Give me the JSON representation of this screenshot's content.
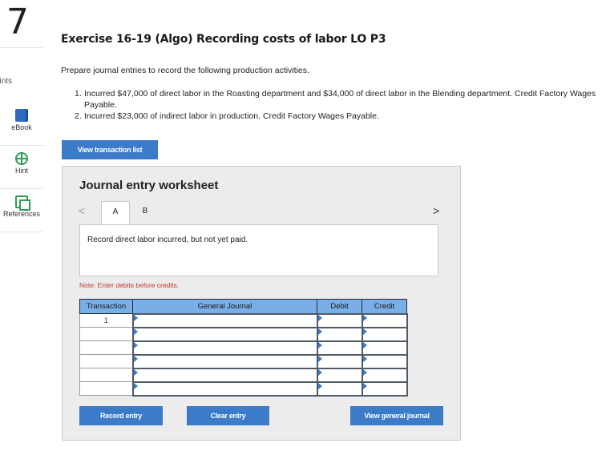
{
  "question": {
    "number": "7",
    "points_label": "oints"
  },
  "rail": [
    {
      "label": "eBook",
      "icon": "book-icon"
    },
    {
      "label": "Hint",
      "icon": "hint-icon"
    },
    {
      "label": "References",
      "icon": "references-icon"
    }
  ],
  "exercise": {
    "title": "Exercise 16-19 (Algo) Recording costs of labor LO P3",
    "intro": "Prepare journal entries to record the following production activities.",
    "items": [
      {
        "num": "1.",
        "text": "Incurred $47,000 of direct labor in the Roasting department and $34,000 of direct labor in the Blending department. Credit Factory Wages Payable."
      },
      {
        "num": "2.",
        "text": "Incurred $23,000 of indirect labor in production. Credit Factory Wages Payable."
      }
    ]
  },
  "buttons": {
    "view_transactions": "View transaction list",
    "record_entry": "Record entry",
    "clear_entry": "Clear entry",
    "view_general_journal": "View general journal"
  },
  "worksheet": {
    "title": "Journal entry worksheet",
    "prev_glyph": "<",
    "next_glyph": ">",
    "tabs": [
      "A",
      "B"
    ],
    "active_tab": "A",
    "description": "Record direct labor incurred, but not yet paid.",
    "note": "Note: Enter debits before credits.",
    "columns": [
      "Transaction",
      "General Journal",
      "Debit",
      "Credit"
    ],
    "rows": [
      {
        "transaction": "1"
      },
      {
        "transaction": ""
      },
      {
        "transaction": ""
      },
      {
        "transaction": ""
      },
      {
        "transaction": ""
      },
      {
        "transaction": ""
      }
    ]
  },
  "colors": {
    "accent": "#3b7bc8",
    "header_blue": "#7aaee6",
    "note_red": "#c0392b"
  }
}
